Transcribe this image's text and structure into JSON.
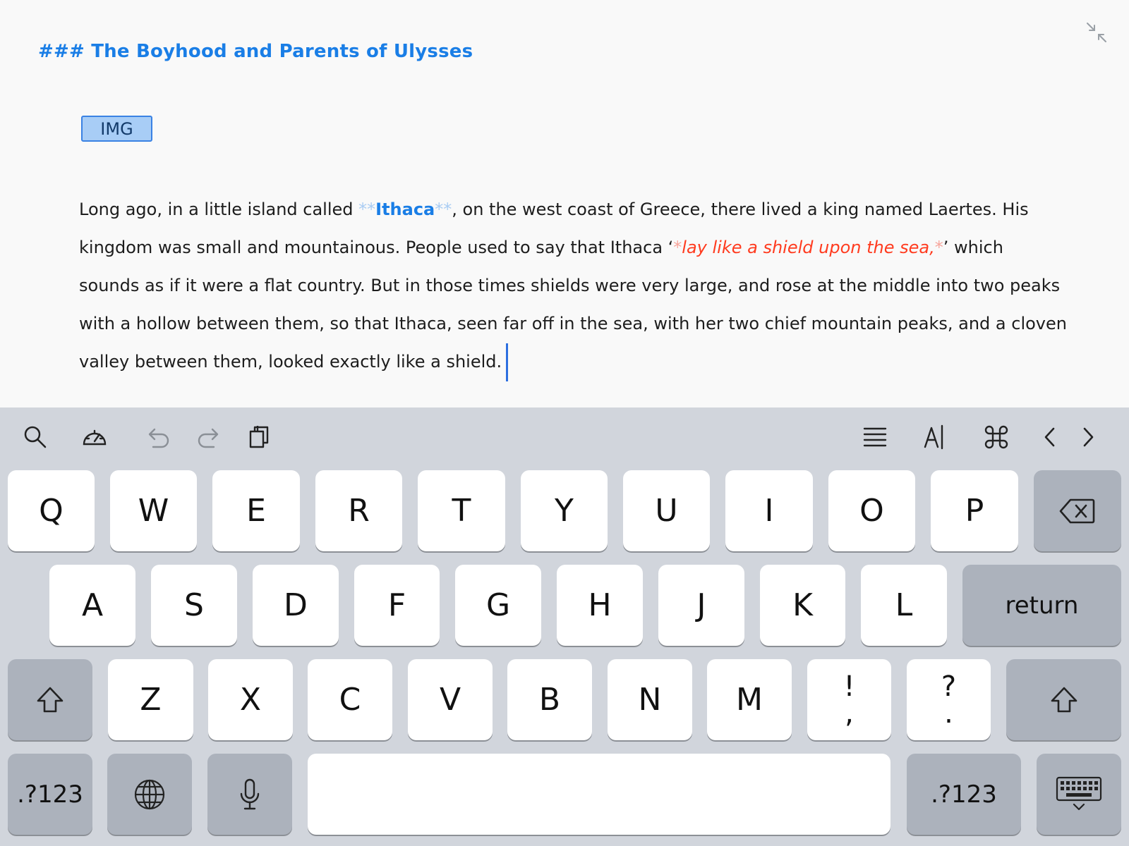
{
  "editor": {
    "heading": "### The Boyhood and Parents of Ulysses",
    "image_tag": "IMG",
    "paragraph": {
      "p1": "Long ago, in a little island called ",
      "bold_marker_open": "**",
      "bold_word": "Ithaca",
      "bold_marker_close": "**",
      "p2": ", on the west coast of Greece, there lived a king named Laertes. His kingdom was small and mountainous. People used to say that Ithaca ‘",
      "italic_marker_open": "*",
      "italic_text": "lay like a shield upon the sea,",
      "italic_marker_close": "*",
      "p3": "’ which sounds as if it were a flat country. But in those times shields were very large, and rose at the middle into two peaks with a hollow between them, so that Ithaca, seen far off in the sea, with her two chief mountain peaks, and a cloven valley between them, looked exactly like a shield."
    }
  },
  "toolbar": {
    "left_icons": [
      "search-icon",
      "speedometer-icon",
      "undo-icon",
      "redo-icon",
      "clipboard-icon"
    ],
    "right_icons": [
      "list-lines-icon",
      "text-cursor-icon",
      "command-icon",
      "chevron-left-icon",
      "chevron-right-icon"
    ]
  },
  "keyboard": {
    "row1": [
      "Q",
      "W",
      "E",
      "R",
      "T",
      "Y",
      "U",
      "I",
      "O",
      "P"
    ],
    "row2": [
      "A",
      "S",
      "D",
      "F",
      "G",
      "H",
      "J",
      "K",
      "L"
    ],
    "return_label": "return",
    "row3": [
      "Z",
      "X",
      "C",
      "V",
      "B",
      "N",
      "M"
    ],
    "punct1_top": "!",
    "punct1_bottom": ",",
    "punct2_top": "?",
    "punct2_bottom": ".",
    "numbers_label": ".?123",
    "colors": {
      "key": "#ffffff",
      "dark_key": "#acb2bc",
      "background": "#d1d5dc",
      "accent": "#1a7ee6",
      "italic": "#ff3b1f"
    }
  }
}
